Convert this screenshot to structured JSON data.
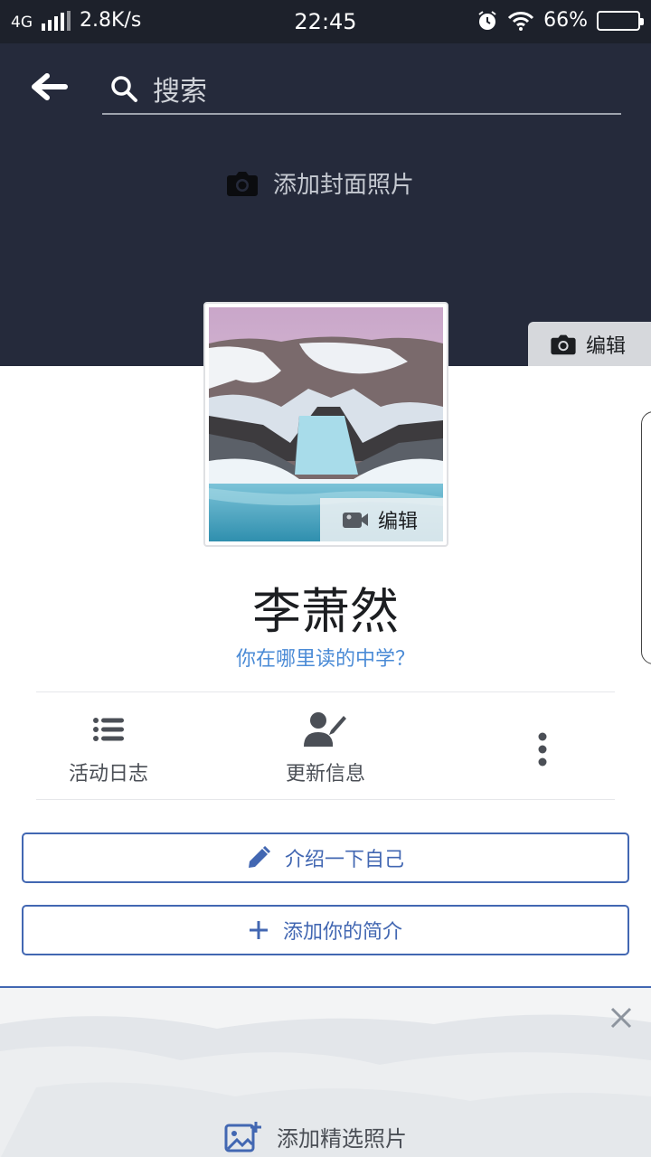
{
  "status_bar": {
    "network": "4G",
    "speed": "2.8K/s",
    "time": "22:45",
    "battery": "66%"
  },
  "search": {
    "placeholder": "搜索"
  },
  "cover": {
    "add_cover_label": "添加封面照片",
    "edit_label": "编辑"
  },
  "profile": {
    "photo_edit_label": "编辑",
    "name": "李萧然",
    "school_prompt": "你在哪里读的中学？"
  },
  "actions": [
    {
      "label": "活动日志",
      "icon": "list-icon"
    },
    {
      "label": "更新信息",
      "icon": "person-edit-icon"
    },
    {
      "label": "",
      "icon": "more-vertical-icon"
    }
  ],
  "buttons": {
    "intro_label": "介绍一下自己",
    "add_bio_label": "添加你的简介"
  },
  "featured": {
    "add_label": "添加精选照片"
  },
  "colors": {
    "cover_bg": "#252a3b",
    "accent": "#4267b2",
    "link": "#4b8bd6"
  }
}
